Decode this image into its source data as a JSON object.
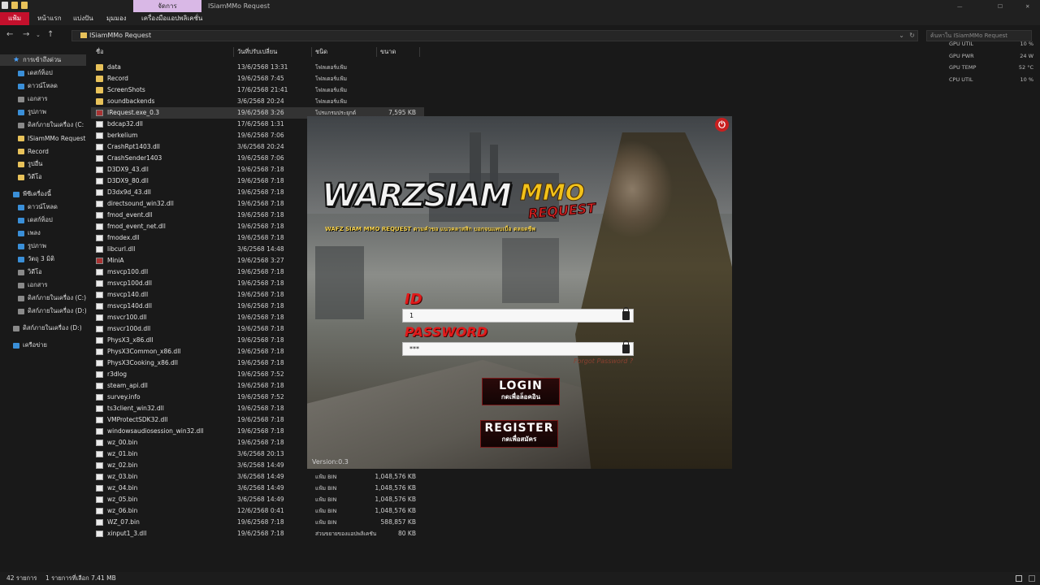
{
  "window": {
    "context_tab": "จัดการ",
    "title": "ISiamMMo Request"
  },
  "ribbon": {
    "file": "แฟ้ม",
    "home": "หน้าแรก",
    "share": "แบ่งปัน",
    "view": "มุมมอง",
    "app_tools": "เครื่องมือแอปพลิเคชั่น"
  },
  "address": {
    "path": "ISiamMMo Request",
    "search_placeholder": "ค้นหาใน ISiamMMo Request"
  },
  "sidebar": {
    "items": [
      {
        "label": "การเข้าถึงด่วน",
        "icon": "star-icon"
      },
      {
        "label": "เดสก์ท็อป",
        "icon": "desktop-icon",
        "pinned": true
      },
      {
        "label": "ดาวน์โหลด",
        "icon": "download-icon",
        "pinned": true
      },
      {
        "label": "เอกสาร",
        "icon": "documents-icon",
        "pinned": true
      },
      {
        "label": "รูปภาพ",
        "icon": "pictures-icon",
        "pinned": true
      },
      {
        "label": "ดิสก์ภายในเครื่อง (C:",
        "icon": "drive-icon",
        "pinned": true
      },
      {
        "label": "ISiamMMo Request",
        "icon": "folder-icon"
      },
      {
        "label": "Record",
        "icon": "folder-icon"
      },
      {
        "label": "รูปอื่น",
        "icon": "folder-icon"
      },
      {
        "label": "วิดีโอ",
        "icon": "folder-icon"
      },
      {
        "label": "พีซีเครื่องนี้",
        "icon": "pc-icon"
      },
      {
        "label": "ดาวน์โหลด",
        "icon": "download-icon"
      },
      {
        "label": "เดสก์ท็อป",
        "icon": "desktop-icon"
      },
      {
        "label": "เพลง",
        "icon": "music-icon"
      },
      {
        "label": "รูปภาพ",
        "icon": "pictures-icon"
      },
      {
        "label": "วัตถุ 3 มิติ",
        "icon": "3d-objects-icon"
      },
      {
        "label": "วิดีโอ",
        "icon": "videos-icon"
      },
      {
        "label": "เอกสาร",
        "icon": "documents-icon"
      },
      {
        "label": "ดิสก์ภายในเครื่อง (C:)",
        "icon": "drive-icon"
      },
      {
        "label": "ดิสก์ภายในเครื่อง (D:)",
        "icon": "drive-icon"
      },
      {
        "label": "ดิสก์ภายในเครื่อง (D:)",
        "icon": "drive-icon"
      },
      {
        "label": "เครือข่าย",
        "icon": "network-icon"
      }
    ]
  },
  "columns": {
    "name": "ชื่อ",
    "date": "วันที่ปรับเปลี่ยน",
    "type": "ชนิด",
    "size": "ขนาด"
  },
  "files": [
    {
      "name": "data",
      "date": "13/6/2568 13:31",
      "type": "โฟลเดอร์แฟ้ม",
      "size": "",
      "kind": "folder"
    },
    {
      "name": "Record",
      "date": "19/6/2568 7:45",
      "type": "โฟลเดอร์แฟ้ม",
      "size": "",
      "kind": "folder"
    },
    {
      "name": "ScreenShots",
      "date": "17/6/2568 21:41",
      "type": "โฟลเดอร์แฟ้ม",
      "size": "",
      "kind": "folder"
    },
    {
      "name": "soundbackends",
      "date": "3/6/2568 20:24",
      "type": "โฟลเดอร์แฟ้ม",
      "size": "",
      "kind": "folder"
    },
    {
      "name": "IRequest.exe_0.3",
      "date": "19/6/2568 3:26",
      "type": "โปรแกรมประยุกต์",
      "size": "7,595 KB",
      "kind": "exe"
    },
    {
      "name": "bdcap32.dll",
      "date": "17/6/2568 1:31",
      "type": "",
      "size": "",
      "kind": "file"
    },
    {
      "name": "berkelium",
      "date": "19/6/2568 7:06",
      "type": "",
      "size": "",
      "kind": "file"
    },
    {
      "name": "CrashRpt1403.dll",
      "date": "3/6/2568 20:24",
      "type": "",
      "size": "",
      "kind": "file"
    },
    {
      "name": "CrashSender1403",
      "date": "19/6/2568 7:06",
      "type": "",
      "size": "",
      "kind": "file"
    },
    {
      "name": "D3DX9_43.dll",
      "date": "19/6/2568 7:18",
      "type": "",
      "size": "",
      "kind": "file"
    },
    {
      "name": "D3DX9_80.dll",
      "date": "19/6/2568 7:18",
      "type": "",
      "size": "",
      "kind": "file"
    },
    {
      "name": "D3dx9d_43.dll",
      "date": "19/6/2568 7:18",
      "type": "",
      "size": "",
      "kind": "file"
    },
    {
      "name": "directsound_win32.dll",
      "date": "19/6/2568 7:18",
      "type": "",
      "size": "",
      "kind": "file"
    },
    {
      "name": "fmod_event.dll",
      "date": "19/6/2568 7:18",
      "type": "",
      "size": "",
      "kind": "file"
    },
    {
      "name": "fmod_event_net.dll",
      "date": "19/6/2568 7:18",
      "type": "",
      "size": "",
      "kind": "file"
    },
    {
      "name": "fmodex.dll",
      "date": "19/6/2568 7:18",
      "type": "",
      "size": "",
      "kind": "file"
    },
    {
      "name": "libcurl.dll",
      "date": "3/6/2568 14:48",
      "type": "",
      "size": "",
      "kind": "file"
    },
    {
      "name": "MiniA",
      "date": "19/6/2568 3:27",
      "type": "",
      "size": "",
      "kind": "exe"
    },
    {
      "name": "msvcp100.dll",
      "date": "19/6/2568 7:18",
      "type": "",
      "size": "",
      "kind": "file"
    },
    {
      "name": "msvcp100d.dll",
      "date": "19/6/2568 7:18",
      "type": "",
      "size": "",
      "kind": "file"
    },
    {
      "name": "msvcp140.dll",
      "date": "19/6/2568 7:18",
      "type": "",
      "size": "",
      "kind": "file"
    },
    {
      "name": "msvcp140d.dll",
      "date": "19/6/2568 7:18",
      "type": "",
      "size": "",
      "kind": "file"
    },
    {
      "name": "msvcr100.dll",
      "date": "19/6/2568 7:18",
      "type": "",
      "size": "",
      "kind": "file"
    },
    {
      "name": "msvcr100d.dll",
      "date": "19/6/2568 7:18",
      "type": "",
      "size": "",
      "kind": "file"
    },
    {
      "name": "PhysX3_x86.dll",
      "date": "19/6/2568 7:18",
      "type": "",
      "size": "",
      "kind": "file"
    },
    {
      "name": "PhysX3Common_x86.dll",
      "date": "19/6/2568 7:18",
      "type": "",
      "size": "",
      "kind": "file"
    },
    {
      "name": "PhysX3Cooking_x86.dll",
      "date": "19/6/2568 7:18",
      "type": "",
      "size": "",
      "kind": "file"
    },
    {
      "name": "r3dlog",
      "date": "19/6/2568 7:52",
      "type": "",
      "size": "",
      "kind": "file"
    },
    {
      "name": "steam_api.dll",
      "date": "19/6/2568 7:18",
      "type": "",
      "size": "",
      "kind": "file"
    },
    {
      "name": "survey.info",
      "date": "19/6/2568 7:52",
      "type": "",
      "size": "",
      "kind": "file"
    },
    {
      "name": "ts3client_win32.dll",
      "date": "19/6/2568 7:18",
      "type": "",
      "size": "",
      "kind": "file"
    },
    {
      "name": "VMProtectSDK32.dll",
      "date": "19/6/2568 7:18",
      "type": "",
      "size": "",
      "kind": "file"
    },
    {
      "name": "windowsaudiosession_win32.dll",
      "date": "19/6/2568 7:18",
      "type": "",
      "size": "",
      "kind": "file"
    },
    {
      "name": "wz_00.bin",
      "date": "19/6/2568 7:18",
      "type": "",
      "size": "",
      "kind": "file"
    },
    {
      "name": "wz_01.bin",
      "date": "3/6/2568 20:13",
      "type": "",
      "size": "",
      "kind": "file"
    },
    {
      "name": "wz_02.bin",
      "date": "3/6/2568 14:49",
      "type": "แฟ้ม BIN",
      "size": "1,048,576 KB",
      "kind": "file"
    },
    {
      "name": "wz_03.bin",
      "date": "3/6/2568 14:49",
      "type": "แฟ้ม BIN",
      "size": "1,048,576 KB",
      "kind": "file"
    },
    {
      "name": "wz_04.bin",
      "date": "3/6/2568 14:49",
      "type": "แฟ้ม BIN",
      "size": "1,048,576 KB",
      "kind": "file"
    },
    {
      "name": "wz_05.bin",
      "date": "3/6/2568 14:49",
      "type": "แฟ้ม BIN",
      "size": "1,048,576 KB",
      "kind": "file"
    },
    {
      "name": "wz_06.bin",
      "date": "12/6/2568 0:41",
      "type": "แฟ้ม BIN",
      "size": "1,048,576 KB",
      "kind": "file"
    },
    {
      "name": "WZ_07.bin",
      "date": "19/6/2568 7:18",
      "type": "แฟ้ม BIN",
      "size": "588,857 KB",
      "kind": "file"
    },
    {
      "name": "xinput1_3.dll",
      "date": "19/6/2568 7:18",
      "type": "ส่วนขยายของแอปพลิเคชัน",
      "size": "80 KB",
      "kind": "file"
    }
  ],
  "launcher": {
    "logo_main": "WARZSIAM",
    "logo_mmo": "MMO",
    "logo_request": "REQUEST",
    "tagline": "WAFZ SIAM MMO REQUEST ตามคำขอ แนวคลาสสิก บอกจนแทบเบื่อ ตลอดชีพ",
    "id_label": "ID",
    "id_value": "1",
    "password_label": "PASSWORD",
    "password_value": "***",
    "forgot": "Forgot Password ?",
    "login_label": "LOGIN",
    "login_sub": "กดเพื่อล็อคอิน",
    "register_label": "REGISTER",
    "register_sub": "กดเพื่อสมัคร",
    "version": "Version:0.3"
  },
  "perf": [
    {
      "label": "GPU UTIL",
      "value": "10 %"
    },
    {
      "label": "GPU PWR",
      "value": "24 W"
    },
    {
      "label": "GPU TEMP",
      "value": "52 °C"
    },
    {
      "label": "CPU UTIL",
      "value": "10 %"
    }
  ],
  "status": {
    "count": "42 รายการ",
    "selected": "1 รายการที่เลือก 7.41 MB"
  },
  "colors": {
    "accent_red": "#c4102c",
    "folder": "#e8c25a"
  }
}
